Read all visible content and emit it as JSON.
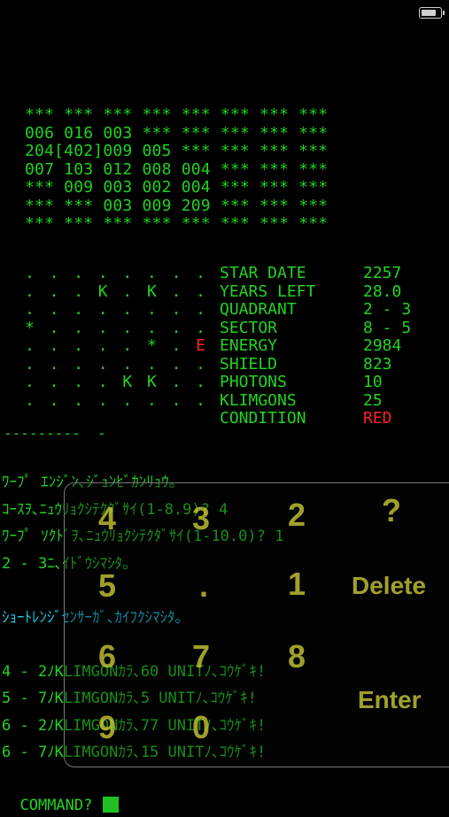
{
  "status_bar": {
    "battery_level": 0.85
  },
  "galaxy_map": [
    [
      "***",
      "***",
      "***",
      "***",
      "***",
      "***",
      "***",
      "***"
    ],
    [
      "006",
      "016",
      "003",
      "***",
      "***",
      "***",
      "***",
      "***"
    ],
    [
      "204",
      "[402]",
      "009",
      "005",
      "***",
      "***",
      "***",
      "***"
    ],
    [
      "007",
      "103",
      "012",
      "008",
      "004",
      "***",
      "***",
      "***"
    ],
    [
      "***",
      "009",
      "003",
      "002",
      "004",
      "***",
      "***",
      "***"
    ],
    [
      "***",
      "***",
      "003",
      "009",
      "209",
      "***",
      "***",
      "***"
    ],
    [
      "***",
      "***",
      "***",
      "***",
      "***",
      "***",
      "***",
      "***"
    ]
  ],
  "sector_map": [
    [
      ".",
      ".",
      ".",
      ".",
      ".",
      ".",
      ".",
      "."
    ],
    [
      ".",
      ".",
      ".",
      "K",
      ".",
      "K",
      ".",
      "."
    ],
    [
      ".",
      ".",
      ".",
      ".",
      ".",
      ".",
      ".",
      "."
    ],
    [
      "*",
      ".",
      ".",
      ".",
      ".",
      ".",
      ".",
      "."
    ],
    [
      ".",
      ".",
      ".",
      ".",
      ".",
      "*",
      ".",
      "E"
    ],
    [
      ".",
      ".",
      ".",
      ".",
      ".",
      ".",
      ".",
      "."
    ],
    [
      ".",
      ".",
      ".",
      ".",
      "K",
      "K",
      ".",
      "."
    ],
    [
      ".",
      ".",
      ".",
      ".",
      ".",
      ".",
      ".",
      "."
    ]
  ],
  "status": [
    {
      "label": "STAR DATE",
      "value": "2257"
    },
    {
      "label": "YEARS LEFT",
      "value": "28.0"
    },
    {
      "label": "QUADRANT",
      "value": "2 - 3"
    },
    {
      "label": "SECTOR",
      "value": "8 - 5"
    },
    {
      "label": "ENERGY",
      "value": "2984"
    },
    {
      "label": "SHIELD",
      "value": "823"
    },
    {
      "label": "PHOTONS",
      "value": "10"
    },
    {
      "label": "KLIMGONS",
      "value": "25"
    },
    {
      "label": "CONDITION",
      "value": "RED"
    }
  ],
  "divider": "---------  -",
  "log": [
    {
      "text": "ﾜｰﾌﾟ ｴﾝｼﾞﾝ､ｼﾞｭﾝﾋﾞｶﾝﾘｮｳ｡",
      "color": "green"
    },
    {
      "text": "ｺｰｽｦ､ﾆｭｳﾘｮｸｼﾃｸﾀﾞｻｲ(1-8.9)? 4",
      "color": "green"
    },
    {
      "text": "ﾜｰﾌﾟ ｿｸﾄﾞｦ､ﾆｭｳﾘｮｸｼﾃｸﾀﾞｻｲ(1-10.0)? 1",
      "color": "green"
    },
    {
      "text": "2 - 3ﾆ､ｲﾄﾞｳｼﾏｼﾀ｡",
      "color": "green"
    },
    {
      "text": "",
      "color": "green"
    },
    {
      "text": "ｼｮｰﾄﾚﾝｼﾞｾﾝｻｰｶﾞ､ｶｲﾌｸｼﾏｼﾀ｡",
      "color": "cyan"
    },
    {
      "text": "",
      "color": "green"
    },
    {
      "text": "4 - 2ﾉKLIMGONｶﾗ､60 UNITﾉ､ｺｳｹﾞｷ!",
      "color": "green"
    },
    {
      "text": "5 - 7ﾉKLIMGONｶﾗ､5 UNITﾉ､ｺｳｹﾞｷ!",
      "color": "green"
    },
    {
      "text": "6 - 2ﾉKLIMGONｶﾗ､77 UNITﾉ､ｺｳｹﾞｷ!",
      "color": "green"
    },
    {
      "text": "6 - 7ﾉKLIMGONｶﾗ､15 UNITﾉ､ｺｳｹﾞｷ!",
      "color": "green"
    }
  ],
  "command_prompt": "COMMAND?",
  "keypad": {
    "k4": "4",
    "k3": "3",
    "k2": "2",
    "kq": "?",
    "k5": "5",
    "kdot": ".",
    "k1": "1",
    "kdel": "Delete",
    "k6": "6",
    "k7": "7",
    "k8": "8",
    "kenter": "Enter",
    "k9": "9",
    "k0": "0"
  },
  "colors": {
    "text": "#22d422",
    "alert": "#ff2020",
    "info": "#16c7e0",
    "key": "#cdcd37"
  }
}
